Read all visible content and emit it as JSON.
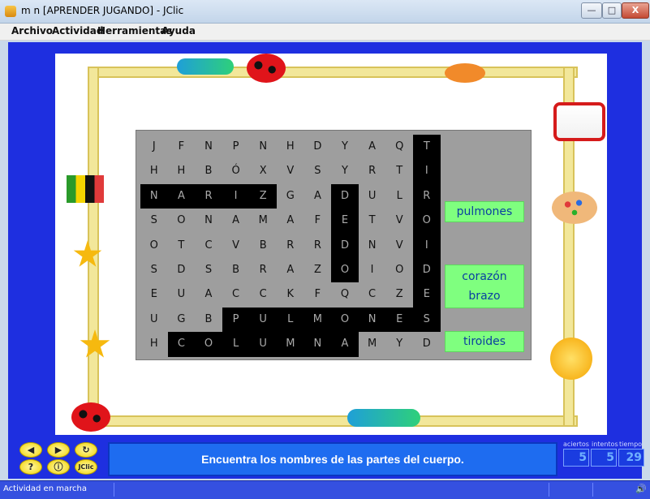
{
  "window": {
    "title": "m n [APRENDER JUGANDO] - JClic",
    "min_glyph": "—",
    "max_glyph": "□",
    "close_glyph": "X"
  },
  "menu": [
    "Archivo",
    "Actividad",
    "Herramientas",
    "Ayuda"
  ],
  "puzzle": {
    "rows": [
      [
        "J",
        "F",
        "N",
        "P",
        "N",
        "H",
        "D",
        "Y",
        "A",
        "Q",
        "T"
      ],
      [
        "H",
        "H",
        "B",
        "Ó",
        "X",
        "V",
        "S",
        "Y",
        "R",
        "T",
        "I"
      ],
      [
        "N",
        "A",
        "R",
        "I",
        "Z",
        "G",
        "A",
        "D",
        "U",
        "L",
        "R"
      ],
      [
        "S",
        "O",
        "N",
        "A",
        "M",
        "A",
        "F",
        "E",
        "T",
        "V",
        "O"
      ],
      [
        "O",
        "T",
        "C",
        "V",
        "B",
        "R",
        "R",
        "D",
        "N",
        "V",
        "I"
      ],
      [
        "S",
        "D",
        "S",
        "B",
        "R",
        "A",
        "Z",
        "O",
        "I",
        "O",
        "D"
      ],
      [
        "E",
        "U",
        "A",
        "C",
        "C",
        "K",
        "F",
        "Q",
        "C",
        "Z",
        "E"
      ],
      [
        "U",
        "G",
        "B",
        "P",
        "U",
        "L",
        "M",
        "O",
        "N",
        "E",
        "S"
      ],
      [
        "H",
        "C",
        "O",
        "L",
        "U",
        "M",
        "N",
        "A",
        "M",
        "Y",
        "D"
      ]
    ],
    "found_cells": [
      [
        0,
        10
      ],
      [
        1,
        10
      ],
      [
        2,
        10
      ],
      [
        3,
        10
      ],
      [
        4,
        10
      ],
      [
        5,
        10
      ],
      [
        6,
        10
      ],
      [
        2,
        0
      ],
      [
        2,
        1
      ],
      [
        2,
        2
      ],
      [
        2,
        3
      ],
      [
        2,
        4
      ],
      [
        2,
        7
      ],
      [
        3,
        7
      ],
      [
        4,
        7
      ],
      [
        5,
        7
      ],
      [
        7,
        3
      ],
      [
        7,
        4
      ],
      [
        7,
        5
      ],
      [
        7,
        6
      ],
      [
        7,
        7
      ],
      [
        7,
        8
      ],
      [
        7,
        9
      ],
      [
        7,
        10
      ],
      [
        6,
        10
      ],
      [
        8,
        1
      ],
      [
        8,
        2
      ],
      [
        8,
        3
      ],
      [
        8,
        4
      ],
      [
        8,
        5
      ],
      [
        8,
        6
      ],
      [
        8,
        7
      ]
    ]
  },
  "found_words": {
    "w1": "pulmones",
    "w2": "corazón",
    "w3": "brazo",
    "w4": "tiroides"
  },
  "controls": {
    "prev_glyph": "◀",
    "next_glyph": "▶",
    "reset_glyph": "↻",
    "help_glyph": "?",
    "info_glyph": "ⓘ",
    "jclic_label": "JClic"
  },
  "message": "Encuentra los nombres de las partes del cuerpo.",
  "counters": {
    "labels": {
      "aciertos": "aciertos",
      "intentos": "intentos",
      "tiempo": "tiempo"
    },
    "aciertos": "5",
    "intentos": "5",
    "tiempo": "29"
  },
  "status": {
    "text": "Actividad en marcha",
    "sound_glyph": "🔊"
  },
  "colors": {
    "stage_blue": "#1e2fe0",
    "highlight": "#000000",
    "word_bg": "#7fff7f",
    "word_text": "#0a3fa0"
  }
}
